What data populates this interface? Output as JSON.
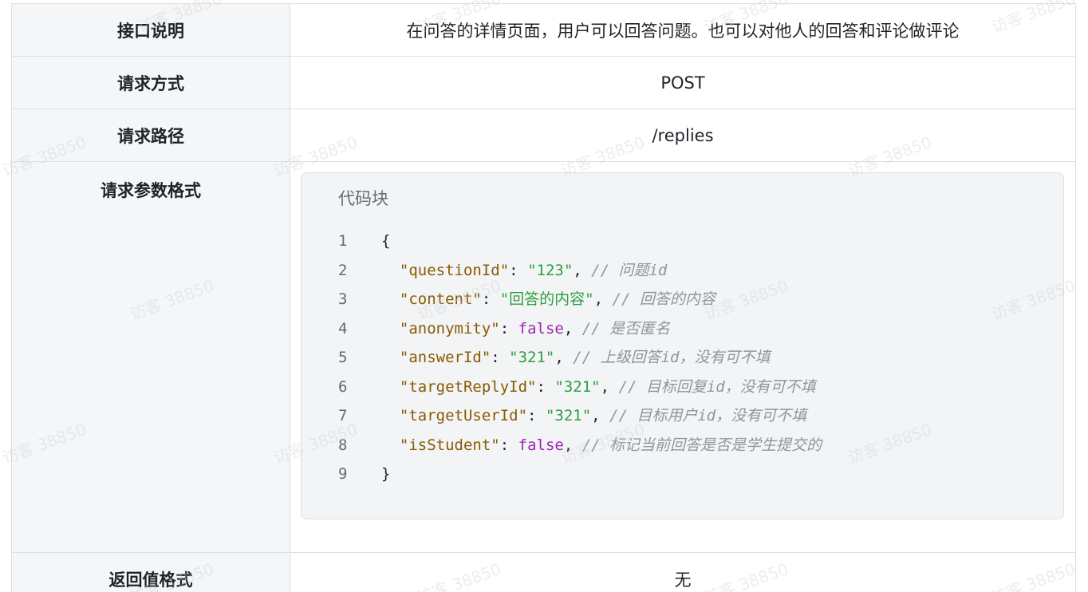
{
  "rows": [
    {
      "label": "接口说明",
      "value": "在问答的详情页面，用户可以回答问题。也可以对他人的回答和评论做评论"
    },
    {
      "label": "请求方式",
      "value": "POST"
    },
    {
      "label": "请求路径",
      "value": "/replies"
    },
    {
      "label": "请求参数格式"
    },
    {
      "label": "返回值格式",
      "value": "无"
    }
  ],
  "code_block": {
    "title": "代码块",
    "lines": [
      {
        "num": "1",
        "open": "{"
      },
      {
        "num": "2",
        "key": "\"questionId\"",
        "colon": ": ",
        "val": "\"123\"",
        "val_type": "str",
        "comma": ", ",
        "comment": "// 问题id"
      },
      {
        "num": "3",
        "key": "\"content\"",
        "colon": ": ",
        "val": "\"回答的内容\"",
        "val_type": "str",
        "comma": ", ",
        "comment": "// 回答的内容"
      },
      {
        "num": "4",
        "key": "\"anonymity\"",
        "colon": ": ",
        "val": "false",
        "val_type": "bool",
        "comma": ", ",
        "comment": "// 是否匿名"
      },
      {
        "num": "5",
        "key": "\"answerId\"",
        "colon": ": ",
        "val": "\"321\"",
        "val_type": "str",
        "comma": ", ",
        "comment": "// 上级回答id，没有可不填"
      },
      {
        "num": "6",
        "key": "\"targetReplyId\"",
        "colon": ": ",
        "val": "\"321\"",
        "val_type": "str",
        "comma": ", ",
        "comment": "// 目标回复id，没有可不填"
      },
      {
        "num": "7",
        "key": "\"targetUserId\"",
        "colon": ": ",
        "val": "\"321\"",
        "val_type": "str",
        "comma": ", ",
        "comment": "// 目标用户id，没有可不填"
      },
      {
        "num": "8",
        "key": "\"isStudent\"",
        "colon": ": ",
        "val": "false",
        "val_type": "bool",
        "comma": ", ",
        "comment": "// 标记当前回答是否是学生提交的"
      },
      {
        "num": "9",
        "open": "}"
      }
    ]
  },
  "watermark": "访客 38850",
  "colors": {
    "label_bg": "#f5f6f7",
    "border": "#dee0e3",
    "code_bg": "#f3f4f6",
    "key": "#8a5a00",
    "string": "#2e9f3e",
    "boolean": "#9c27b0",
    "comment": "#8f959e"
  }
}
